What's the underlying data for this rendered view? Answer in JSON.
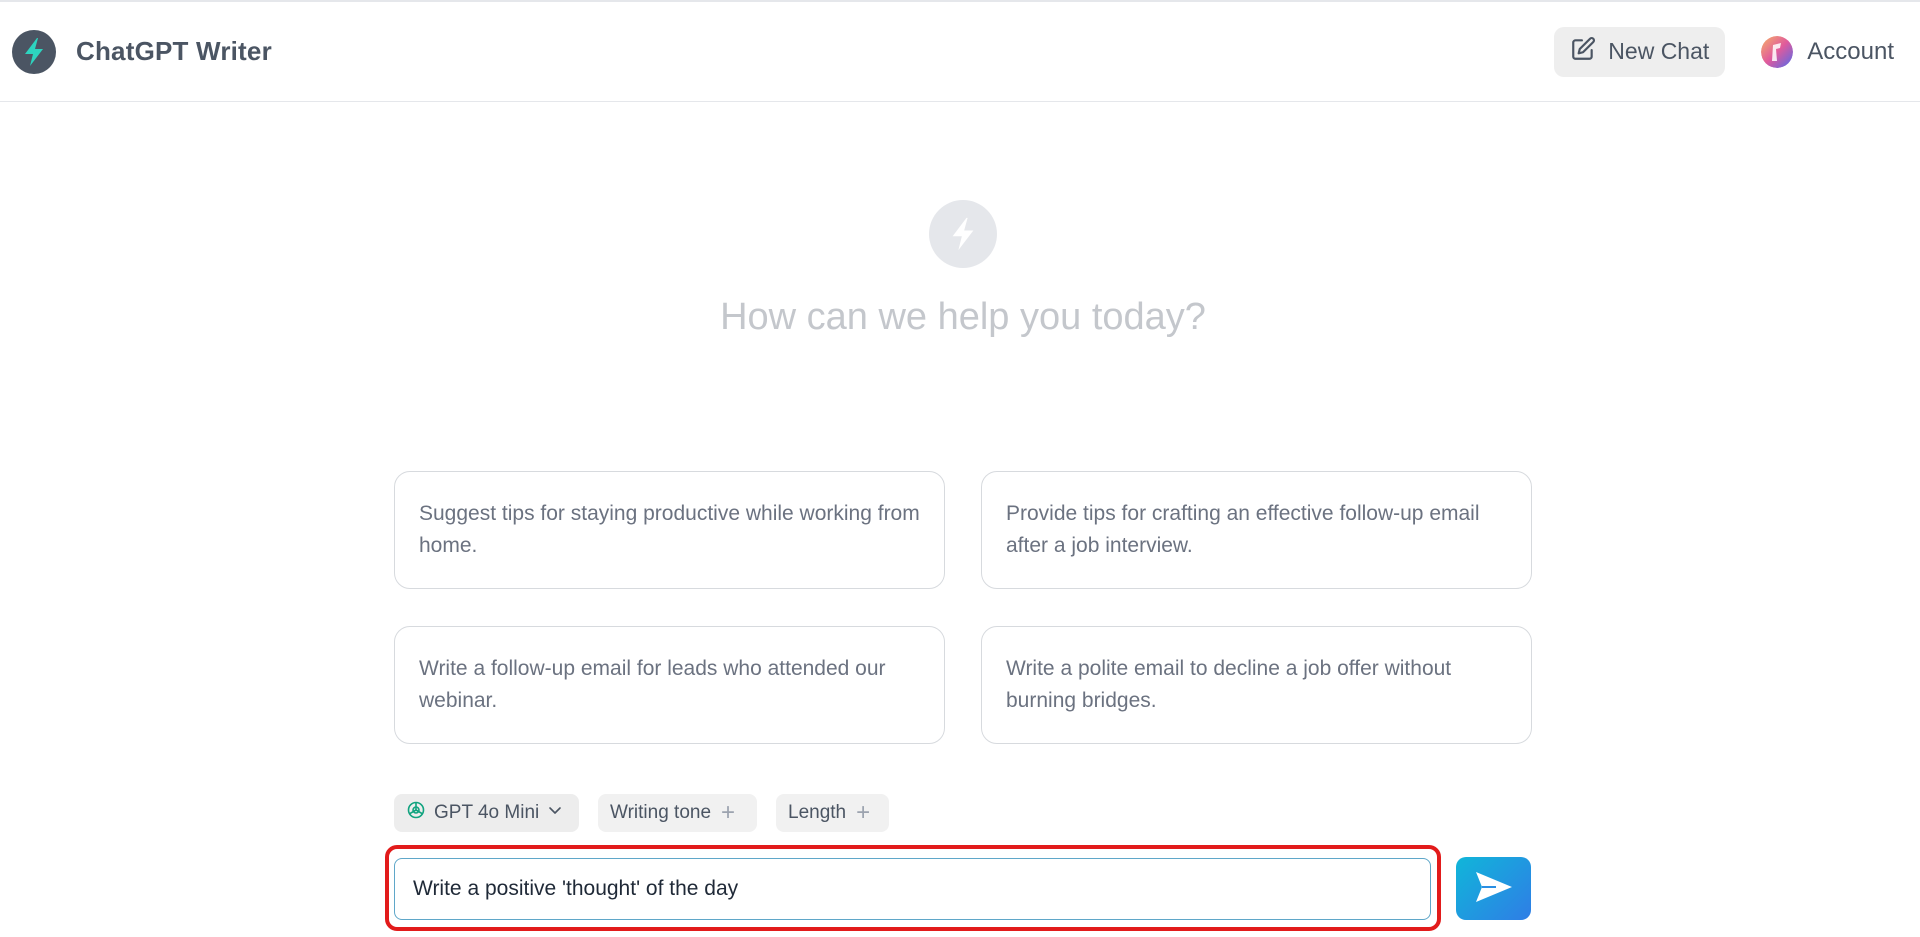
{
  "header": {
    "app_title": "ChatGPT Writer",
    "new_chat_label": "New Chat",
    "account_label": "Account"
  },
  "hero": {
    "title": "How can we help you today?"
  },
  "suggestions": [
    "Suggest tips for staying productive while working from home.",
    "Provide tips for crafting an effective follow-up email after a job interview.",
    "Write a follow-up email for leads who attended our webinar.",
    "Write a polite email to decline a job offer without burning bridges."
  ],
  "options": {
    "model_label": "GPT 4o Mini",
    "tone_label": "Writing tone",
    "length_label": "Length"
  },
  "composer": {
    "input_value": "Write a positive 'thought' of the day"
  },
  "colors": {
    "accent_gradient_start": "#10b6d9",
    "accent_gradient_end": "#2f7de6",
    "brand_bolt": "#2dd4bf",
    "highlight_red": "#e21b1b"
  },
  "icons": {
    "brand": "lightning-bolt-icon",
    "new_chat": "edit-icon",
    "model": "openai-icon",
    "dropdown": "chevron-down-icon",
    "add": "plus-icon",
    "send": "send-icon"
  }
}
